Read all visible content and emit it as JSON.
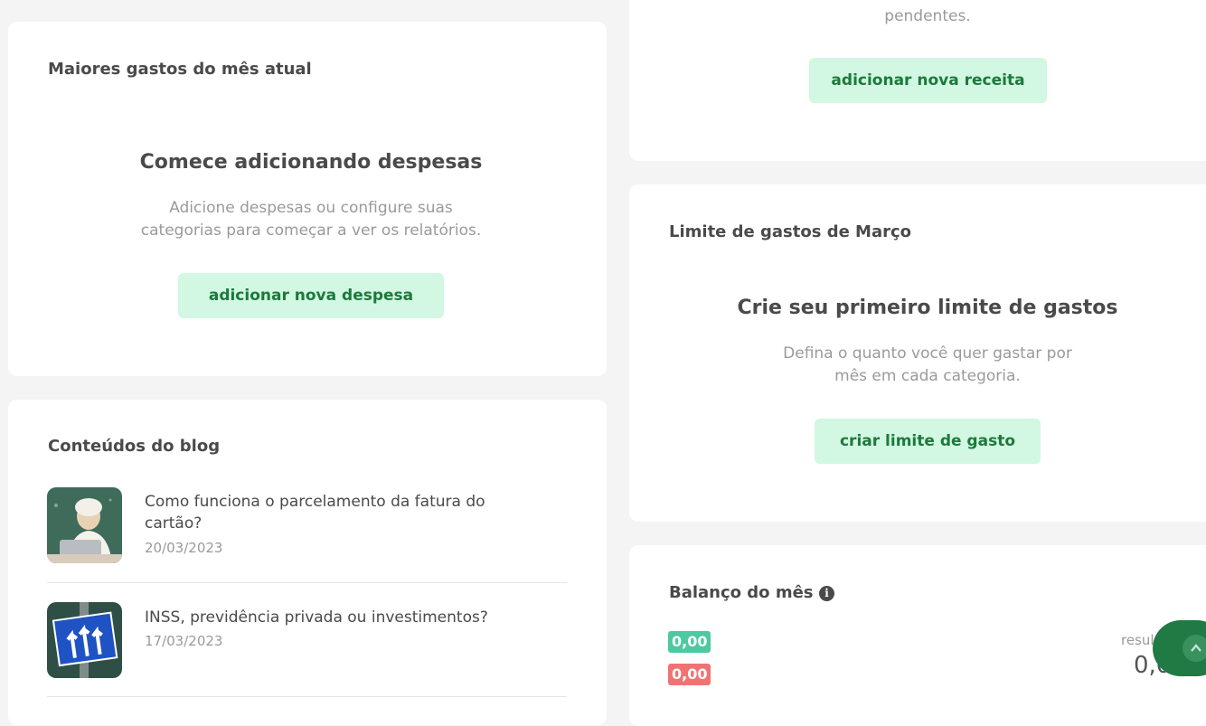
{
  "colors": {
    "accent_green": "#1c7a3a",
    "button_bg": "#d2f7e2",
    "income_green": "#4cc9a0",
    "expense_red": "#f07373",
    "fab_green": "#1f7a44"
  },
  "top_expenses": {
    "title": "Maiores gastos do mês atual",
    "empty_title": "Comece adicionando despesas",
    "empty_description": "Adicione despesas ou configure suas categorias para começar a ver os relatórios.",
    "button_label": "adicionar nova despesa"
  },
  "blog": {
    "title": "Conteúdos do blog",
    "posts": [
      {
        "title": "Como funciona o parcelamento da fatura do cartão?",
        "date": "20/03/2023",
        "thumb_icon": "woman-with-laptop-photo"
      },
      {
        "title": "INSS, previdência privada ou investimentos?",
        "date": "17/03/2023",
        "thumb_icon": "road-sign-arrows-photo"
      }
    ]
  },
  "income": {
    "partial_text": "pendentes.",
    "button_label": "adicionar nova receita"
  },
  "spending_limit": {
    "title": "Limite de gastos de Março",
    "empty_title": "Crie seu primeiro limite de gastos",
    "empty_description": "Defina o quanto você quer gastar por mês em cada categoria.",
    "button_label": "criar limite de gasto"
  },
  "balance": {
    "title": "Balanço do mês",
    "info_icon": "info-icon",
    "income_value": "0,00",
    "expense_value": "0,00",
    "result_label": "resul",
    "result_value": "0,0"
  },
  "fab": {
    "icon": "chevron-up-icon"
  }
}
